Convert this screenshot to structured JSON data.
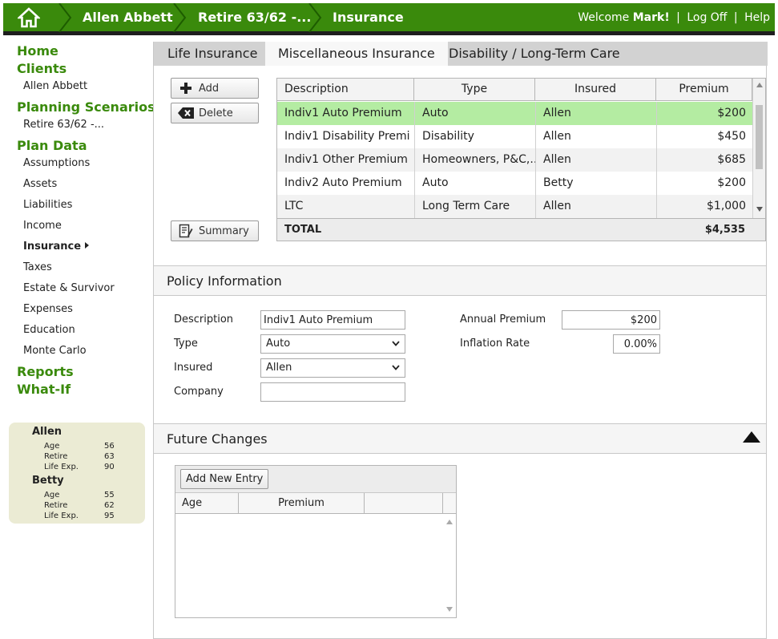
{
  "topbar": {
    "crumbs": [
      "Allen Abbett",
      "Retire 63/62 -...",
      "Insurance"
    ],
    "welcome_prefix": "Welcome",
    "user_name": "Mark!",
    "logoff_label": "Log Off",
    "help_label": "Help",
    "separator": "|"
  },
  "sidebar": {
    "home": "Home",
    "clients": "Clients",
    "client_name": "Allen Abbett",
    "planning_scenarios": "Planning Scenarios",
    "scenario_name": "Retire 63/62 -...",
    "plan_data": "Plan Data",
    "plan_items": [
      "Assumptions",
      "Assets",
      "Liabilities",
      "Income",
      "Insurance",
      "Taxes",
      "Estate & Survivor",
      "Expenses",
      "Education",
      "Monte Carlo"
    ],
    "reports": "Reports",
    "what_if": "What-If"
  },
  "people": [
    {
      "name": "Allen",
      "age_label": "Age",
      "age": "56",
      "retire_label": "Retire",
      "retire": "63",
      "life_label": "Life Exp.",
      "life": "90"
    },
    {
      "name": "Betty",
      "age_label": "Age",
      "age": "55",
      "retire_label": "Retire",
      "retire": "62",
      "life_label": "Life Exp.",
      "life": "95"
    }
  ],
  "tabs": [
    "Life Insurance",
    "Miscellaneous Insurance",
    "Disability / Long-Term Care"
  ],
  "buttons": {
    "add": "Add",
    "delete": "Delete",
    "summary": "Summary"
  },
  "grid": {
    "headers": [
      "Description",
      "Type",
      "Insured",
      "Premium"
    ],
    "rows": [
      {
        "description": "Indiv1 Auto Premium",
        "type": "Auto",
        "insured": "Allen",
        "premium": "$200"
      },
      {
        "description": "Indiv1 Disability Premi...",
        "type": "Disability",
        "insured": "Allen",
        "premium": "$450"
      },
      {
        "description": "Indiv1 Other Premium",
        "type": "Homeowners, P&C,...",
        "insured": "Allen",
        "premium": "$685"
      },
      {
        "description": "Indiv2 Auto Premium",
        "type": "Auto",
        "insured": "Betty",
        "premium": "$200"
      },
      {
        "description": "LTC",
        "type": "Long Term Care",
        "insured": "Allen",
        "premium": "$1,000"
      }
    ],
    "total_label": "TOTAL",
    "total_value": "$4,535"
  },
  "policy": {
    "title": "Policy Information",
    "description_label": "Description",
    "description_value": "Indiv1 Auto Premium",
    "type_label": "Type",
    "type_value": "Auto",
    "insured_label": "Insured",
    "insured_value": "Allen",
    "company_label": "Company",
    "company_value": "",
    "annual_premium_label": "Annual Premium",
    "annual_premium_value": "$200",
    "inflation_label": "Inflation Rate",
    "inflation_value": "0.00%"
  },
  "future": {
    "title": "Future Changes",
    "add_entry": "Add New Entry",
    "headers": [
      "Age",
      "Premium"
    ]
  },
  "colors": {
    "brand_green": "#3a8a0c",
    "selected_row": "#b4eca2",
    "people_bg": "#ebebd4"
  }
}
